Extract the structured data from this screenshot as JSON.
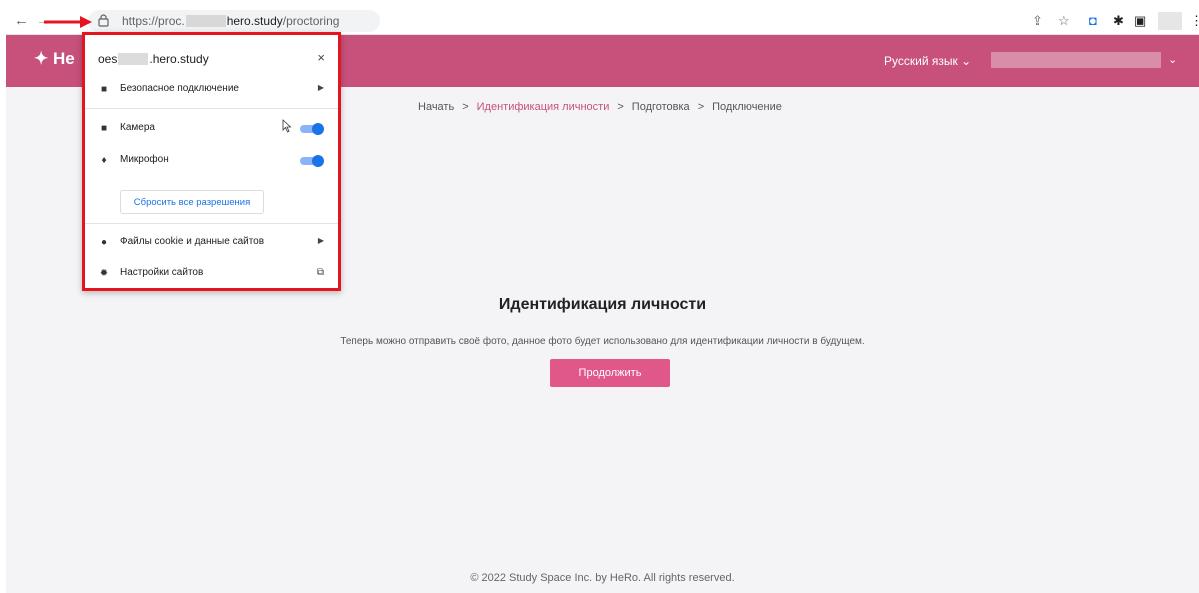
{
  "browser": {
    "url_prefix": "https://proc.",
    "url_domain": "hero.study",
    "url_path": "/proctoring",
    "back_icon": "←",
    "forward_icon": "→",
    "toolbar_icons": [
      "share-icon",
      "star-icon",
      "extension-icon",
      "puzzle-icon",
      "sidebar-icon",
      "menu-icon"
    ]
  },
  "site_header": {
    "logo_text": "He",
    "language": "Русский язык",
    "chevron": "⌄"
  },
  "breadcrumb": {
    "items": [
      "Начать",
      "Идентификация личности",
      "Подготовка",
      "Подключение"
    ],
    "separator": ">"
  },
  "main": {
    "title": "Идентификация личности",
    "subtitle": "Теперь можно отправить своё фото, данное фото будет использовано для идентификации личности в будущем.",
    "continue_label": "Продолжить"
  },
  "footer": {
    "text": "© 2022 Study Space Inc. by HeRo. All rights reserved."
  },
  "popup": {
    "host_prefix": "oes",
    "host_suffix": ".hero.study",
    "close": "×",
    "secure_label": "Безопасное подключение",
    "camera_label": "Камера",
    "camera_enabled": true,
    "mic_label": "Микрофон",
    "mic_enabled": true,
    "reset_label": "Сбросить все разрешения",
    "cookies_label": "Файлы cookie и данные сайтов",
    "settings_label": "Настройки сайтов"
  },
  "colors": {
    "brand": "#c7517a",
    "button": "#e0588a",
    "highlight": "#e4151f",
    "toggle": "#1a73e8"
  }
}
